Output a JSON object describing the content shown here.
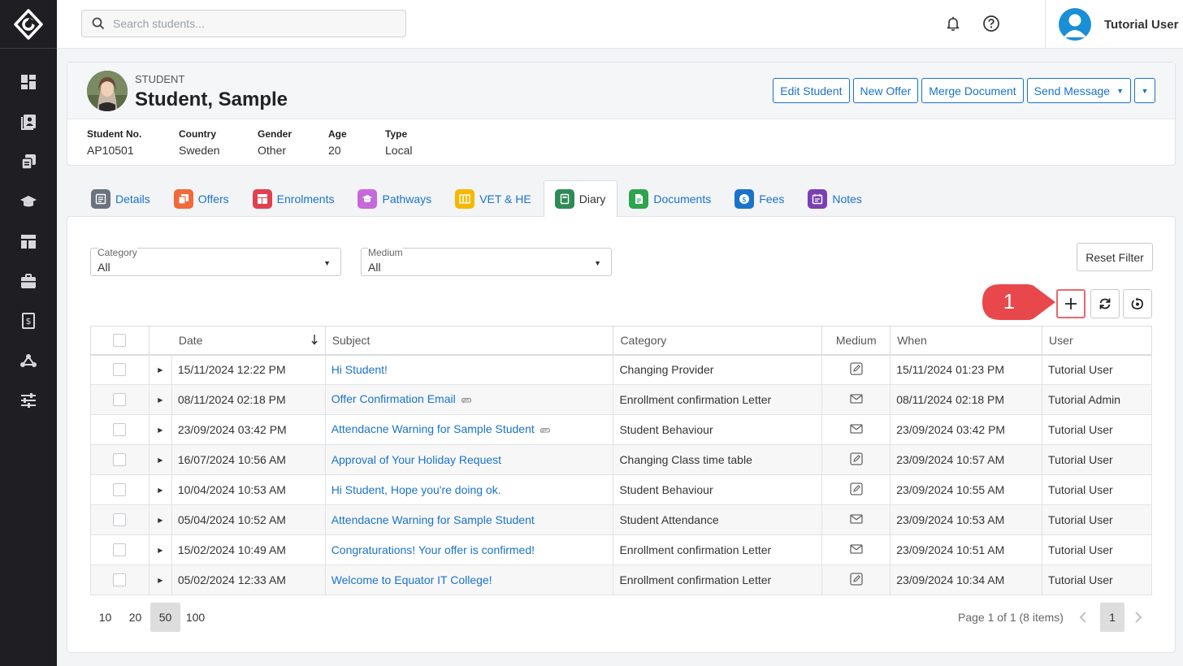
{
  "search": {
    "placeholder": "Search students..."
  },
  "user": {
    "name": "Tutorial User"
  },
  "student": {
    "label": "STUDENT",
    "name": "Student, Sample",
    "buttons": {
      "edit": "Edit Student",
      "new_offer": "New Offer",
      "merge": "Merge Document",
      "send_message": "Send Message"
    },
    "info": [
      {
        "key": "Student No.",
        "value": "AP10501"
      },
      {
        "key": "Country",
        "value": "Sweden"
      },
      {
        "key": "Gender",
        "value": "Other"
      },
      {
        "key": "Age",
        "value": "20"
      },
      {
        "key": "Type",
        "value": "Local"
      }
    ]
  },
  "tabs": [
    {
      "label": "Details",
      "color": "#6b7280",
      "icon": "details-icon"
    },
    {
      "label": "Offers",
      "color": "#f06a3b",
      "icon": "offers-icon"
    },
    {
      "label": "Enrolments",
      "color": "#e0414f",
      "icon": "enrolments-icon"
    },
    {
      "label": "Pathways",
      "color": "#c56ad8",
      "icon": "pathways-icon"
    },
    {
      "label": "VET & HE",
      "color": "#f5b800",
      "icon": "vet-he-icon"
    },
    {
      "label": "Diary",
      "color": "#2e8b57",
      "icon": "diary-icon",
      "active": true
    },
    {
      "label": "Documents",
      "color": "#2ea44f",
      "icon": "documents-icon"
    },
    {
      "label": "Fees",
      "color": "#1a73c8",
      "icon": "fees-icon"
    },
    {
      "label": "Notes",
      "color": "#7b3fb5",
      "icon": "notes-icon"
    }
  ],
  "filters": {
    "category": {
      "label": "Category",
      "value": "All"
    },
    "medium": {
      "label": "Medium",
      "value": "All"
    },
    "reset": "Reset Filter"
  },
  "callout": {
    "number": "1"
  },
  "table": {
    "headers": {
      "date": "Date",
      "subject": "Subject",
      "category": "Category",
      "medium": "Medium",
      "when": "When",
      "user": "User"
    },
    "rows": [
      {
        "date": "15/11/2024 12:22 PM",
        "subject": "Hi Student!",
        "attachment": false,
        "category": "Changing Provider",
        "medium": "note-icon",
        "when": "15/11/2024 01:23 PM",
        "user": "Tutorial User"
      },
      {
        "date": "08/11/2024 02:18 PM",
        "subject": "Offer Confirmation Email",
        "attachment": true,
        "category": "Enrollment confirmation Letter",
        "medium": "email-icon",
        "when": "08/11/2024 02:18 PM",
        "user": "Tutorial Admin"
      },
      {
        "date": "23/09/2024 03:42 PM",
        "subject": "Attendacne Warning for Sample Student",
        "attachment": true,
        "category": "Student Behaviour",
        "medium": "email-icon",
        "when": "23/09/2024 03:42 PM",
        "user": "Tutorial User"
      },
      {
        "date": "16/07/2024 10:56 AM",
        "subject": "Approval of Your Holiday Request",
        "attachment": false,
        "category": "Changing Class time table",
        "medium": "note-icon",
        "when": "23/09/2024 10:57 AM",
        "user": "Tutorial User"
      },
      {
        "date": "10/04/2024 10:53 AM",
        "subject": "Hi Student, Hope you're doing ok.",
        "attachment": false,
        "category": "Student Behaviour",
        "medium": "note-icon",
        "when": "23/09/2024 10:55 AM",
        "user": "Tutorial User"
      },
      {
        "date": "05/04/2024 10:52 AM",
        "subject": "Attendacne Warning for Sample Student",
        "attachment": false,
        "category": "Student Attendance",
        "medium": "email-icon",
        "when": "23/09/2024 10:53 AM",
        "user": "Tutorial User"
      },
      {
        "date": "15/02/2024 10:49 AM",
        "subject": "Congraturations! Your offer is confirmed!",
        "attachment": false,
        "category": "Enrollment confirmation Letter",
        "medium": "email-icon",
        "when": "23/09/2024 10:51 AM",
        "user": "Tutorial User"
      },
      {
        "date": "05/02/2024 12:33 AM",
        "subject": "Welcome to Equator IT College!",
        "attachment": false,
        "category": "Enrollment confirmation Letter",
        "medium": "note-icon",
        "when": "23/09/2024 10:34 AM",
        "user": "Tutorial User"
      }
    ]
  },
  "pager": {
    "sizes": [
      "10",
      "20",
      "50",
      "100"
    ],
    "active_size": "50",
    "info": "Page 1 of 1 (8 items)",
    "current_page": "1"
  }
}
